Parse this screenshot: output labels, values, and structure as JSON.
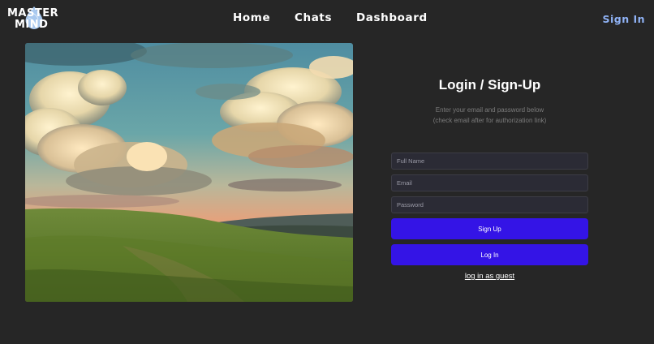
{
  "brand": {
    "logo_line1": "MASTER",
    "logo_line2": "MIND",
    "logo_color": "#a9c9ef"
  },
  "nav": {
    "items": [
      {
        "label": "Home"
      },
      {
        "label": "Chats"
      },
      {
        "label": "Dashboard"
      }
    ],
    "signin_label": "Sign In"
  },
  "hero": {
    "icon": "landscape-sunset-image"
  },
  "form": {
    "title": "Login / Sign-Up",
    "subtitle_line1": "Enter your email and password below",
    "subtitle_line2": "(check email after for authorization link)",
    "fullname_placeholder": "Full Name",
    "email_placeholder": "Email",
    "password_placeholder": "Password",
    "signup_label": "Sign Up",
    "login_label": "Log In",
    "guest_label": "log in as guest"
  },
  "colors": {
    "background": "#262626",
    "accent_button": "#3414e6",
    "signin_link": "#8fb2f5",
    "input_bg": "#2b2b35"
  }
}
